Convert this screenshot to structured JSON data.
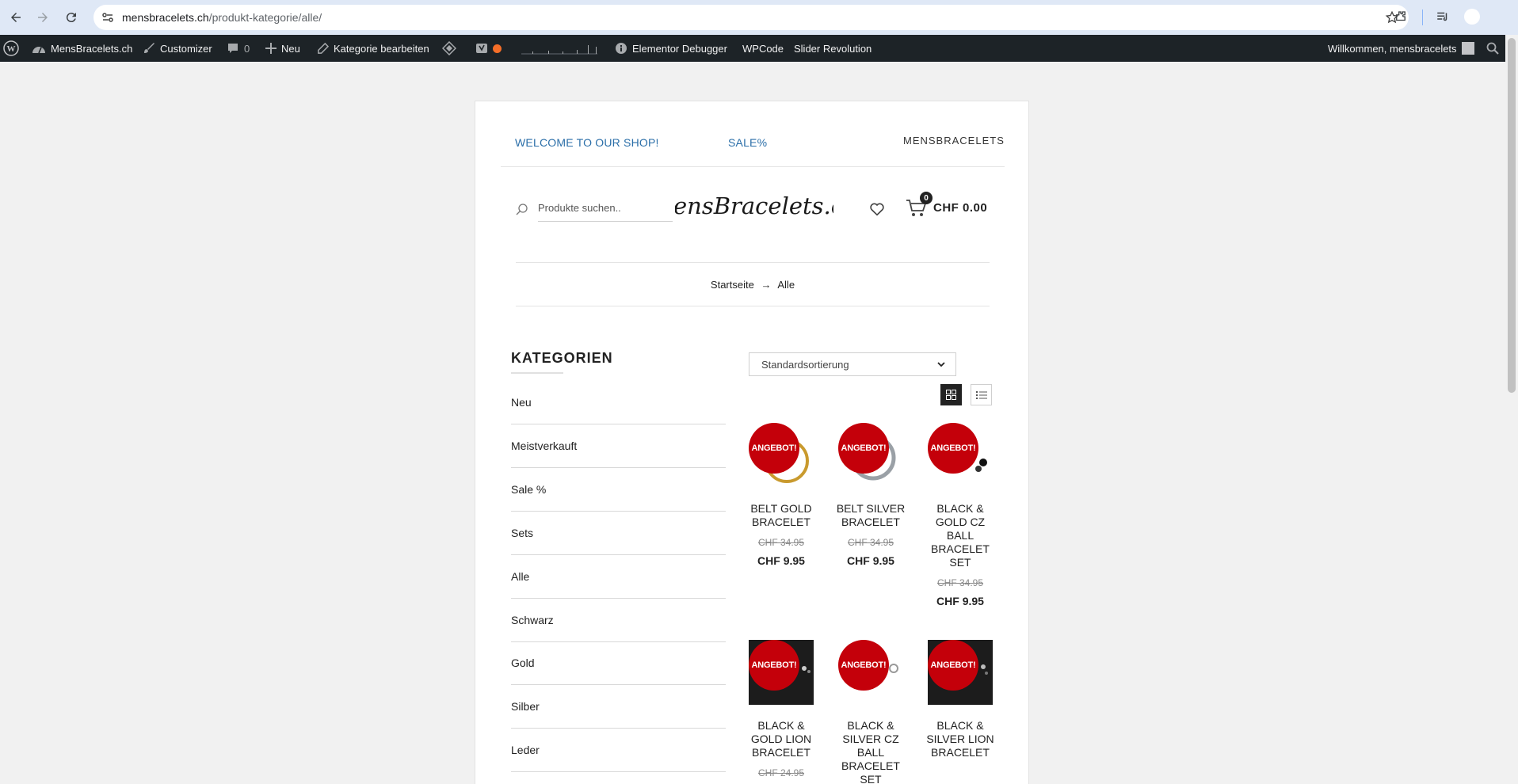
{
  "browser": {
    "url_host": "mensbracelets.ch",
    "url_path": "/produkt-kategorie/alle/"
  },
  "adminbar": {
    "site": "MensBracelets.ch",
    "customizer": "Customizer",
    "comments": "0",
    "new": "Neu",
    "edit_category": "Kategorie bearbeiten",
    "elementor_debugger": "Elementor Debugger",
    "wpcode": "WPCode",
    "slider_revolution": "Slider Revolution",
    "welcome": "Willkommen, mensbracelets"
  },
  "header": {
    "welcome": "WELCOME TO OUR SHOP!",
    "sale": "SALE%",
    "brand": "MENSBRACELETS",
    "search_placeholder": "Produkte suchen..",
    "logo_text": "MensBracelets.ch",
    "cart_count": "0",
    "cart_total": "CHF 0.00"
  },
  "breadcrumb": {
    "home": "Startseite",
    "separator": "→",
    "current": "Alle"
  },
  "sidebar": {
    "title": "KATEGORIEN",
    "items": [
      "Neu",
      "Meistverkauft",
      "Sale %",
      "Sets",
      "Alle",
      "Schwarz",
      "Gold",
      "Silber",
      "Leder"
    ]
  },
  "shop": {
    "sort_label": "Standardsortierung",
    "badge": "ANGEBOT!",
    "products": [
      {
        "name": "Belt Gold Bracelet",
        "old_price": "CHF 34.95",
        "price": "CHF 9.95"
      },
      {
        "name": "Belt Silver Bracelet",
        "old_price": "CHF 34.95",
        "price": "CHF 9.95"
      },
      {
        "name": "Black & Gold CZ Ball Bracelet Set",
        "old_price": "CHF 34.95",
        "price": "CHF 9.95"
      },
      {
        "name": "Black & Gold Lion Bracelet",
        "old_price": "CHF 24.95",
        "price": ""
      },
      {
        "name": "Black & Silver CZ Ball Bracelet Set",
        "old_price": "",
        "price": ""
      },
      {
        "name": "Black & Silver Lion Bracelet",
        "old_price": "",
        "price": ""
      }
    ]
  },
  "colors": {
    "accent_link": "#2a6ea8",
    "badge_red": "#c4000a",
    "adminbar_bg": "#1d2327"
  }
}
